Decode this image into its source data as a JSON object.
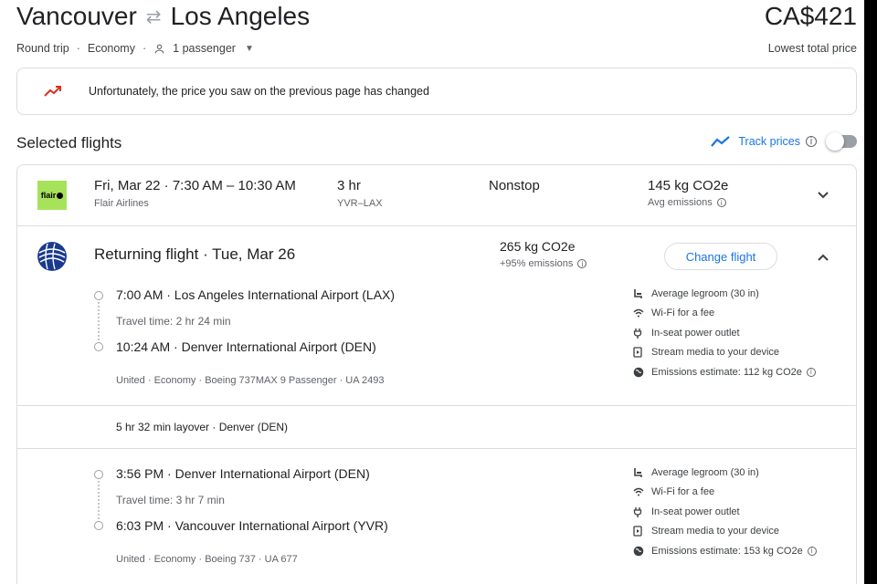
{
  "header": {
    "origin": "Vancouver",
    "swap_icon": "swap-arrows-icon",
    "destination": "Los Angeles",
    "price": "CA$421",
    "trip_type": "Round trip",
    "cabin": "Economy",
    "passengers": "1 passenger",
    "price_note": "Lowest total price"
  },
  "notice": {
    "icon": "trending-up-icon",
    "text": "Unfortunately, the price you saw on the previous page has changed"
  },
  "selected": {
    "title": "Selected flights",
    "track_label": "Track prices",
    "track_enabled": false
  },
  "outbound": {
    "logo": "flair",
    "times": "Fri, Mar 22  ·  7:30 AM – 10:30 AM",
    "airline": "Flair Airlines",
    "duration": "3 hr",
    "route": "YVR–LAX",
    "stops": "Nonstop",
    "emissions": "145 kg CO2e",
    "emissions_note": "Avg emissions"
  },
  "return": {
    "title": "Returning flight  ·  Tue, Mar 26",
    "emissions": "265 kg CO2e",
    "emissions_note": "+95% emissions",
    "change_label": "Change flight",
    "segments": [
      {
        "depart": "7:00 AM  ·  Los Angeles International Airport (LAX)",
        "travel": "Travel time: 2 hr 24 min",
        "arrive": "10:24 AM  ·  Denver International Airport (DEN)",
        "info": "United  ·  Economy  ·  Boeing 737MAX 9 Passenger  ·  UA 2493",
        "amenities": [
          {
            "icon": "legroom-icon",
            "text": "Average legroom (30 in)"
          },
          {
            "icon": "wifi-icon",
            "text": "Wi-Fi for a fee"
          },
          {
            "icon": "power-plug-icon",
            "text": "In-seat power outlet"
          },
          {
            "icon": "stream-media-icon",
            "text": "Stream media to your device"
          },
          {
            "icon": "globe-icon",
            "text": "Emissions estimate: 112 kg CO2e"
          }
        ]
      },
      {
        "depart": "3:56 PM  ·  Denver International Airport (DEN)",
        "travel": "Travel time: 3 hr 7 min",
        "arrive": "6:03 PM  ·  Vancouver International Airport (YVR)",
        "info": "United  ·  Economy  ·  Boeing 737  ·  UA 677",
        "amenities": [
          {
            "icon": "legroom-icon",
            "text": "Average legroom (30 in)"
          },
          {
            "icon": "wifi-icon",
            "text": "Wi-Fi for a fee"
          },
          {
            "icon": "power-plug-icon",
            "text": "In-seat power outlet"
          },
          {
            "icon": "stream-media-icon",
            "text": "Stream media to your device"
          },
          {
            "icon": "globe-icon",
            "text": "Emissions estimate: 153 kg CO2e"
          }
        ]
      }
    ],
    "layover": "5 hr 32 min layover  ·  Denver (DEN)"
  },
  "colors": {
    "accent": "#1a73e8",
    "alert": "#d93025",
    "flair_brand": "#a6e35a",
    "united_brand": "#1a3a8f"
  }
}
